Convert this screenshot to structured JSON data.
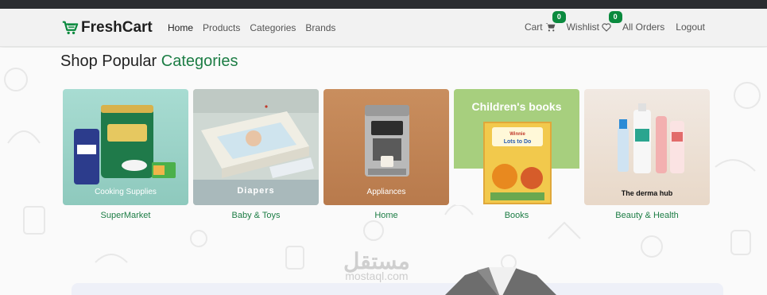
{
  "brand": {
    "name": "FreshCart",
    "accent": "#0a8a3e"
  },
  "nav": {
    "links": [
      "Home",
      "Products",
      "Categories",
      "Brands"
    ],
    "cart_label": "Cart",
    "cart_count": "0",
    "wishlist_label": "Wishlist",
    "wishlist_count": "0",
    "orders_label": "All Orders",
    "logout_label": "Logout"
  },
  "section": {
    "title_part1": "Shop Popular ",
    "title_part2": "Categories"
  },
  "categories": [
    {
      "name": "SuperMarket",
      "overlay": "Cooking Supplies",
      "icon": "grocery-image"
    },
    {
      "name": "Baby & Toys",
      "overlay": "Diapers",
      "icon": "diapers-image"
    },
    {
      "name": "Home",
      "overlay": "Appliances",
      "icon": "coffee-machine-image"
    },
    {
      "name": "Books",
      "overlay": "Children's books",
      "book_title": "Winnie the Pooh Lots to Do for Pooh",
      "icon": "book-image"
    },
    {
      "name": "Beauty & Health",
      "overlay": "The derma hub",
      "icon": "cosmetics-image"
    }
  ],
  "watermark": {
    "arabic": "مستقل",
    "latin": "mostaql.com"
  }
}
